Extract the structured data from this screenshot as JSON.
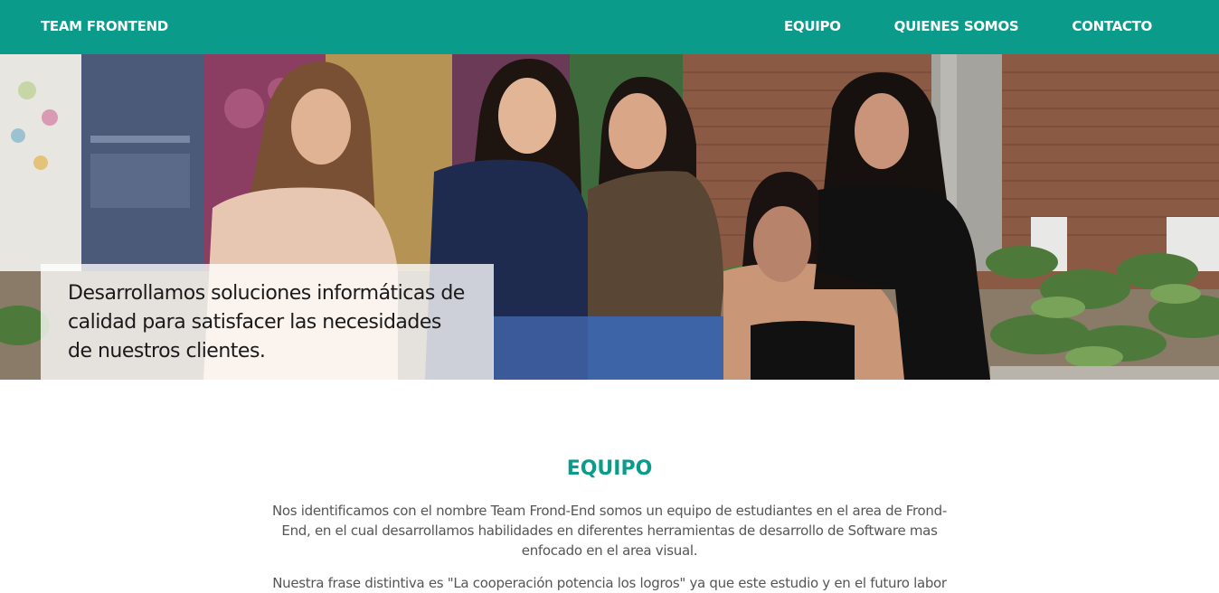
{
  "navbar": {
    "brand": "TEAM FRONTEND",
    "links": [
      {
        "label": "EQUIPO"
      },
      {
        "label": "QUIENES SOMOS"
      },
      {
        "label": "CONTACTO"
      }
    ],
    "background_color": "#0b9b8a"
  },
  "hero": {
    "caption": "Desarrollamos soluciones informáticas de calidad para satisfacer las necesidades de nuestros clientes."
  },
  "equipo": {
    "title": "EQUIPO",
    "paragraph_1": "Nos identificamos con el nombre Team Frond-End somos un equipo de estudiantes en el area de Frond-End, en el cual desarrollamos habilidades en diferentes herramientas de desarrollo de Software mas enfocado en el area visual.",
    "paragraph_2": "Nuestra frase distintiva es \"La cooperación potencia los logros\" ya que este estudio y en el futuro labor",
    "title_color": "#0b9b8a"
  }
}
